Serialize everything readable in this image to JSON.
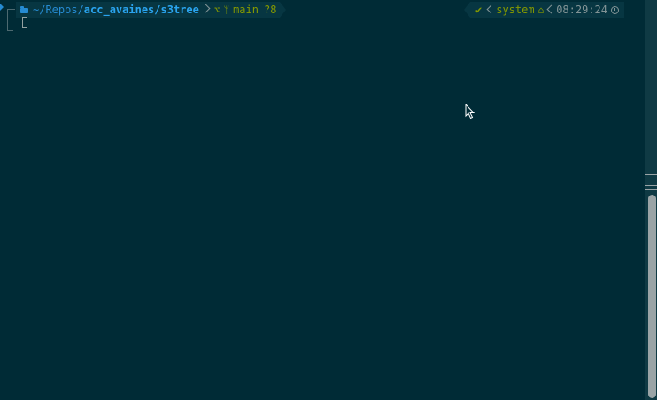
{
  "prompt": {
    "path_prefix": "~/Repos/",
    "path_bold": "acc_avaines/s3tree",
    "git_icon": "git-icon",
    "branch_icon": "branch-icon",
    "branch": "main",
    "status": "?8",
    "check": "✔",
    "env": "system",
    "env_icon": "house-icon",
    "time": "08:29:24",
    "time_icon": "clock-icon"
  },
  "colors": {
    "background": "#002b36",
    "segment_bg": "#073642",
    "path_blue": "#268bd2",
    "git_green": "#859900",
    "text_grey": "#839496"
  }
}
